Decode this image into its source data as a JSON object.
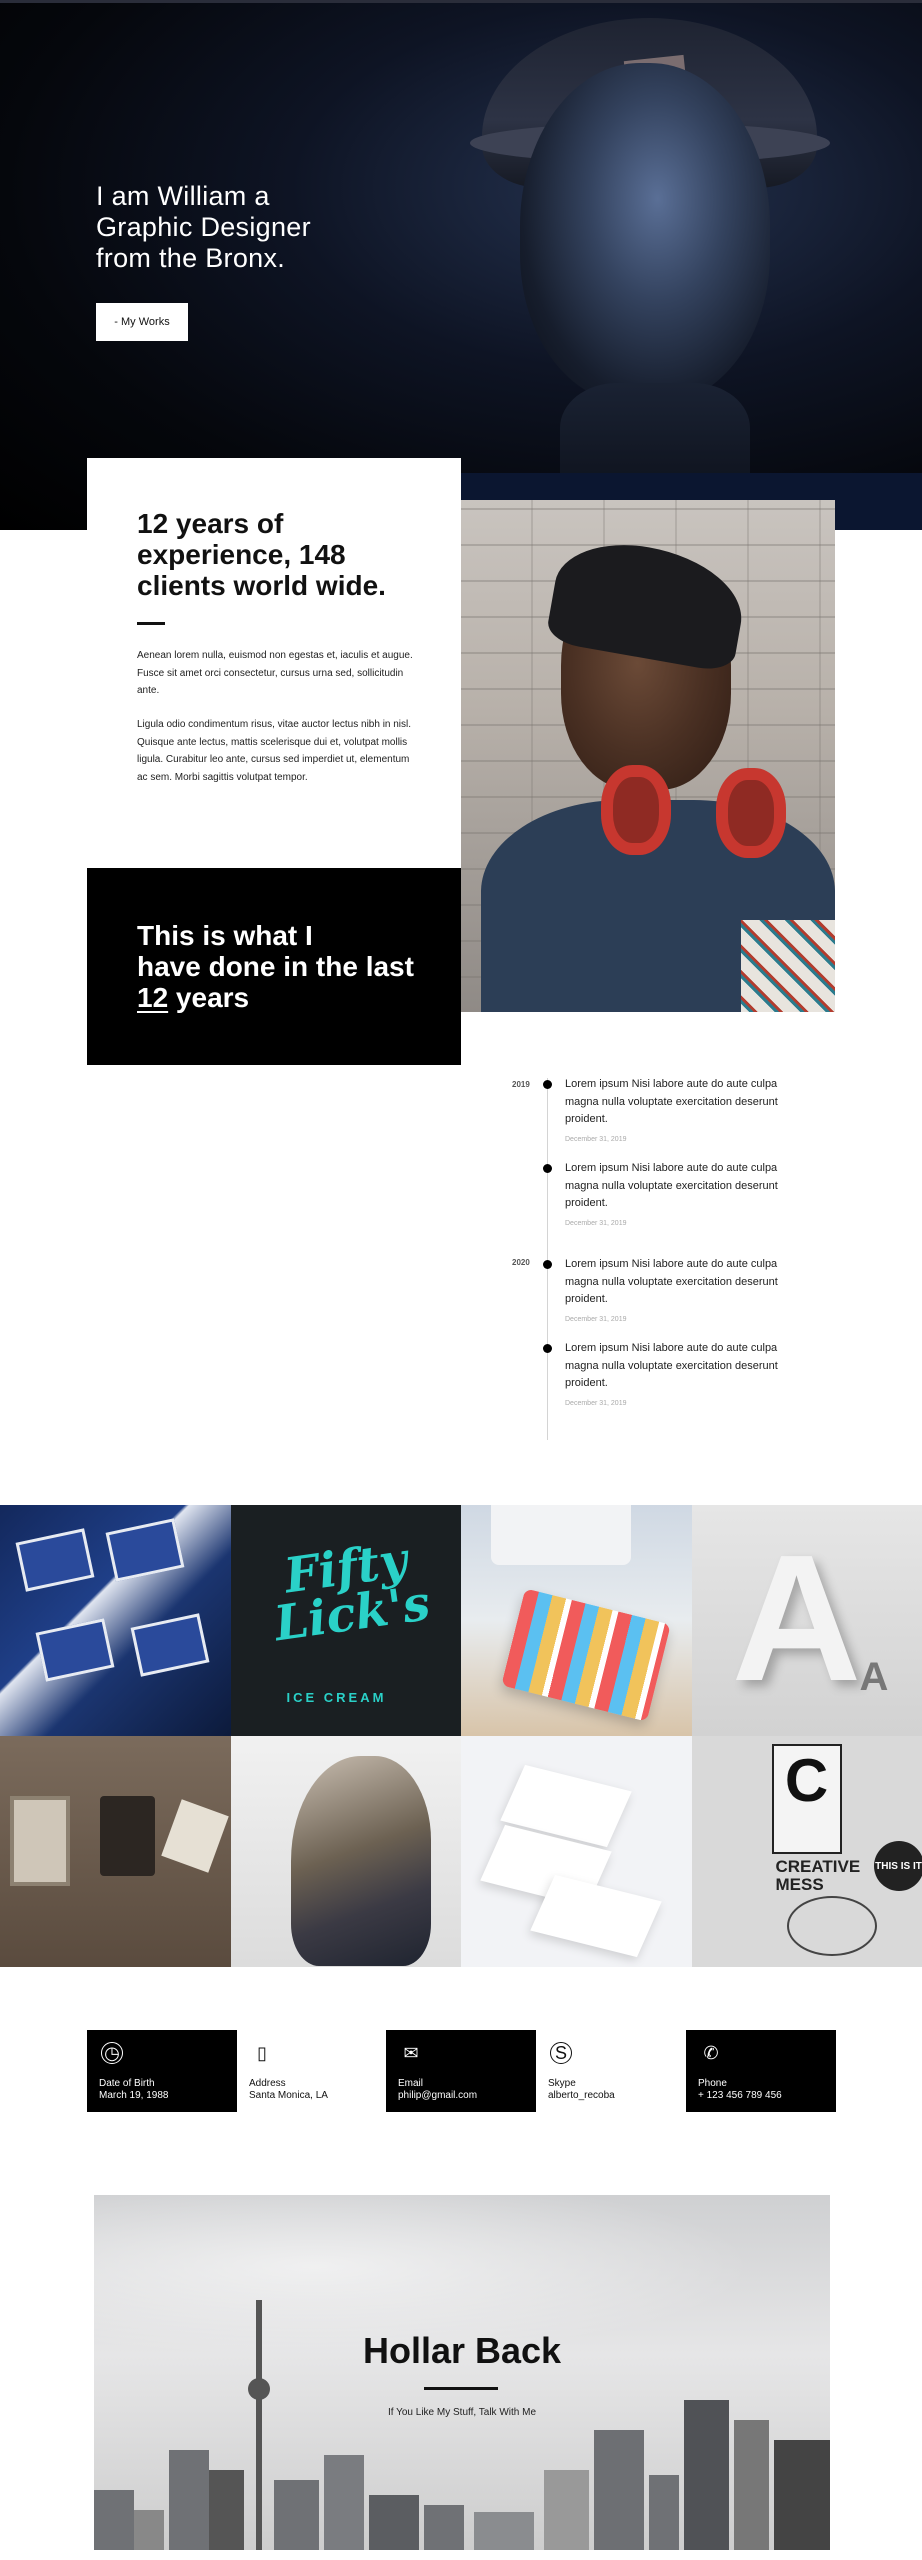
{
  "hero": {
    "title": "I am William a\nGraphic Designer\nfrom the Bronx.",
    "button_label": "- My Works"
  },
  "about": {
    "title": "12 years of\nexperience, 148\nclients world wide.",
    "paragraph_1": "Aenean lorem nulla, euismod non egestas et, iaculis et augue. Fusce sit amet orci consectetur, cursus urna sed, sollicitudin ante.",
    "paragraph_2": "Ligula odio condimentum risus, vitae auctor lectus nibh in nisl. Quisque ante lectus, mattis scelerisque dui et, volutpat mollis ligula. Curabitur leo ante, cursus sed imperdiet ut, elementum ac sem. Morbi sagittis volutpat tempor."
  },
  "experience": {
    "line1": "This is what I",
    "line2": "have done in the last",
    "highlight": "12",
    "line3_rest": " years"
  },
  "timeline": {
    "years": [
      "2019",
      "2020"
    ],
    "entries": [
      {
        "text": "Lorem ipsum Nisi labore aute do aute culpa magna nulla voluptate exercitation deserunt proident.",
        "date": "December 31, 2019"
      },
      {
        "text": "Lorem ipsum Nisi labore aute do aute culpa magna nulla voluptate exercitation deserunt proident.",
        "date": "December 31, 2019"
      },
      {
        "text": "Lorem ipsum Nisi labore aute do aute culpa magna nulla voluptate exercitation deserunt proident.",
        "date": "December 31, 2019"
      },
      {
        "text": "Lorem ipsum Nisi labore aute do aute culpa magna nulla voluptate exercitation deserunt proident.",
        "date": "December 31, 2019"
      }
    ]
  },
  "gallery": {
    "fifty_licks_logo": "Fifty Lick's",
    "fifty_licks_sub": "ICE CREAM",
    "letter_big": "A",
    "letter_small": "A",
    "creative_letter": "C",
    "creative_text": "CREATIVE MESS",
    "this_is_it": "THIS IS IT"
  },
  "contact": {
    "items": [
      {
        "icon": "clock-icon",
        "label": "Date of Birth",
        "value": "March 19, 1988"
      },
      {
        "icon": "map-icon",
        "label": "Address",
        "value": "Santa Monica, LA"
      },
      {
        "icon": "mail-icon",
        "label": "Email",
        "value": "philip@gmail.com"
      },
      {
        "icon": "skype-icon",
        "label": "Skype",
        "value": "alberto_recoba"
      },
      {
        "icon": "phone-icon",
        "label": "Phone",
        "value": "+ 123 456 789 456"
      }
    ]
  },
  "footer": {
    "title": "Hollar Back",
    "subtitle": "If You Like My Stuff, Talk With Me"
  },
  "colors": {
    "dark": "#000000",
    "accent_teal": "#2ad1c8",
    "headphone_red": "#c7372f"
  }
}
